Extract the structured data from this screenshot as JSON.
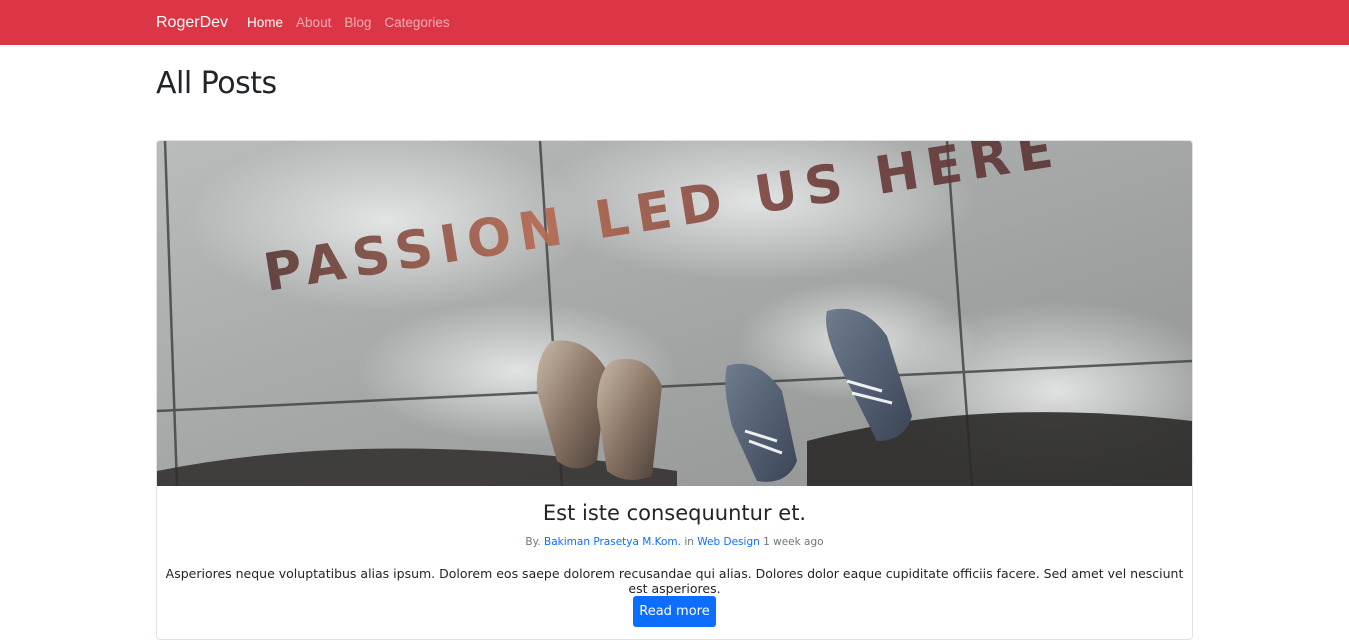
{
  "navbar": {
    "brand": "RogerDev",
    "links": [
      {
        "label": "Home",
        "active": true
      },
      {
        "label": "About",
        "active": false
      },
      {
        "label": "Blog",
        "active": false
      },
      {
        "label": "Categories",
        "active": false
      }
    ],
    "bg_color": "#dc3545"
  },
  "page": {
    "title": "All Posts"
  },
  "post": {
    "image_text": "PASSION LED US HERE",
    "title": "Est iste consequuntur et.",
    "meta_by": "By.",
    "author": "Bakiman Prasetya M.Kom.",
    "meta_in": "in",
    "category": "Web Design",
    "time": "1 week ago",
    "excerpt": "Asperiores neque voluptatibus alias ipsum. Dolorem eos saepe dolorem recusandae qui alias. Dolores dolor eaque cupiditate officiis facere. Sed amet vel nesciunt est asperiores.",
    "read_more": "Read more"
  },
  "colors": {
    "accent": "#dc3545",
    "link": "#0d6efd",
    "button": "#0d6efd"
  }
}
